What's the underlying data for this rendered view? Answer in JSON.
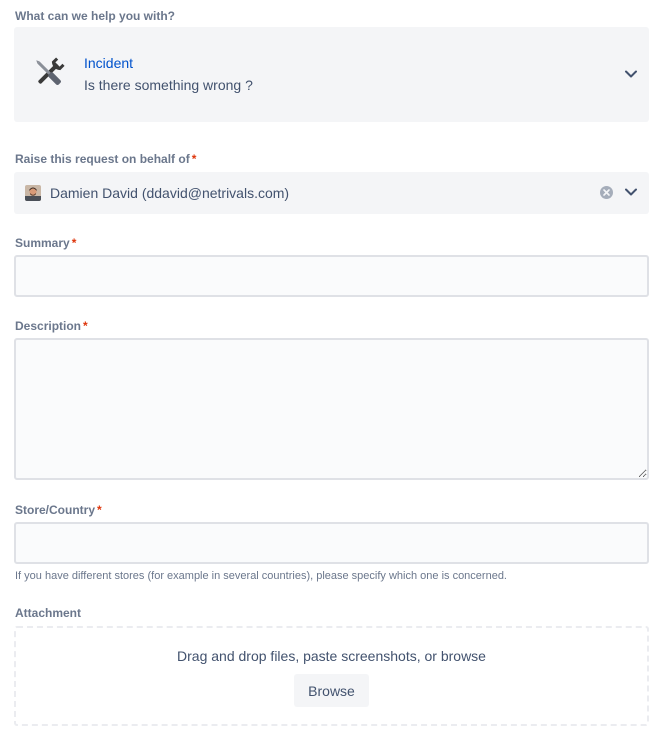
{
  "request_type": {
    "label": "What can we help you with?",
    "name": "Incident",
    "description": "Is there something wrong ?",
    "icon": "tools-icon"
  },
  "on_behalf": {
    "label": "Raise this request on behalf of",
    "required_mark": "*",
    "user": "Damien David (ddavid@netrivals.com)"
  },
  "summary": {
    "label": "Summary",
    "required_mark": "*",
    "value": ""
  },
  "description": {
    "label": "Description",
    "required_mark": "*",
    "value": ""
  },
  "store_country": {
    "label": "Store/Country",
    "required_mark": "*",
    "value": "",
    "helper": "If you have different stores (for example in several countries), please specify which one is concerned."
  },
  "attachment": {
    "label": "Attachment",
    "drop_text": "Drag and drop files, paste screenshots, or browse",
    "browse_label": "Browse"
  },
  "colors": {
    "link": "#0052cc",
    "required": "#de350b",
    "field_bg": "#f4f5f7",
    "border": "#dfe1e6"
  }
}
